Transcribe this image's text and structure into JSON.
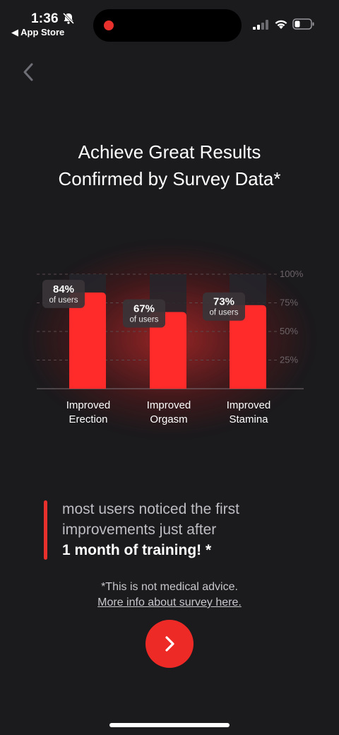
{
  "status_bar": {
    "time": "1:36",
    "back_app": "◀ App Store",
    "icons": [
      "bell-slash-icon",
      "signal-icon",
      "wifi-icon",
      "battery-icon"
    ]
  },
  "nav": {
    "back_icon": "chevron-left-icon"
  },
  "headline": {
    "line1": "Achieve Great Results",
    "line2": "Confirmed by Survey Data*"
  },
  "chart_data": {
    "type": "bar",
    "categories": [
      [
        "Improved",
        "Erection"
      ],
      [
        "Improved",
        "Orgasm"
      ],
      [
        "Improved",
        "Stamina"
      ]
    ],
    "values": [
      84,
      67,
      73
    ],
    "value_labels": [
      "84%",
      "67%",
      "73%"
    ],
    "value_sublabel": "of users",
    "yticks": [
      "100%",
      "75%",
      "50%",
      "25%"
    ],
    "ylim": [
      0,
      100
    ],
    "grid": true,
    "colors": {
      "bar": "#ff2a2a",
      "track": "#24262c"
    }
  },
  "quote": {
    "line1": "most users noticed the first",
    "line2": "improvements just after",
    "line3": "1 month of training! *"
  },
  "disclaimer": {
    "text": "*This is not medical advice.",
    "link": "More info about survey here."
  },
  "next_button": {
    "icon": "chevron-right-icon"
  },
  "colors": {
    "accent": "#ee2a27",
    "background": "#1b1a1d"
  }
}
